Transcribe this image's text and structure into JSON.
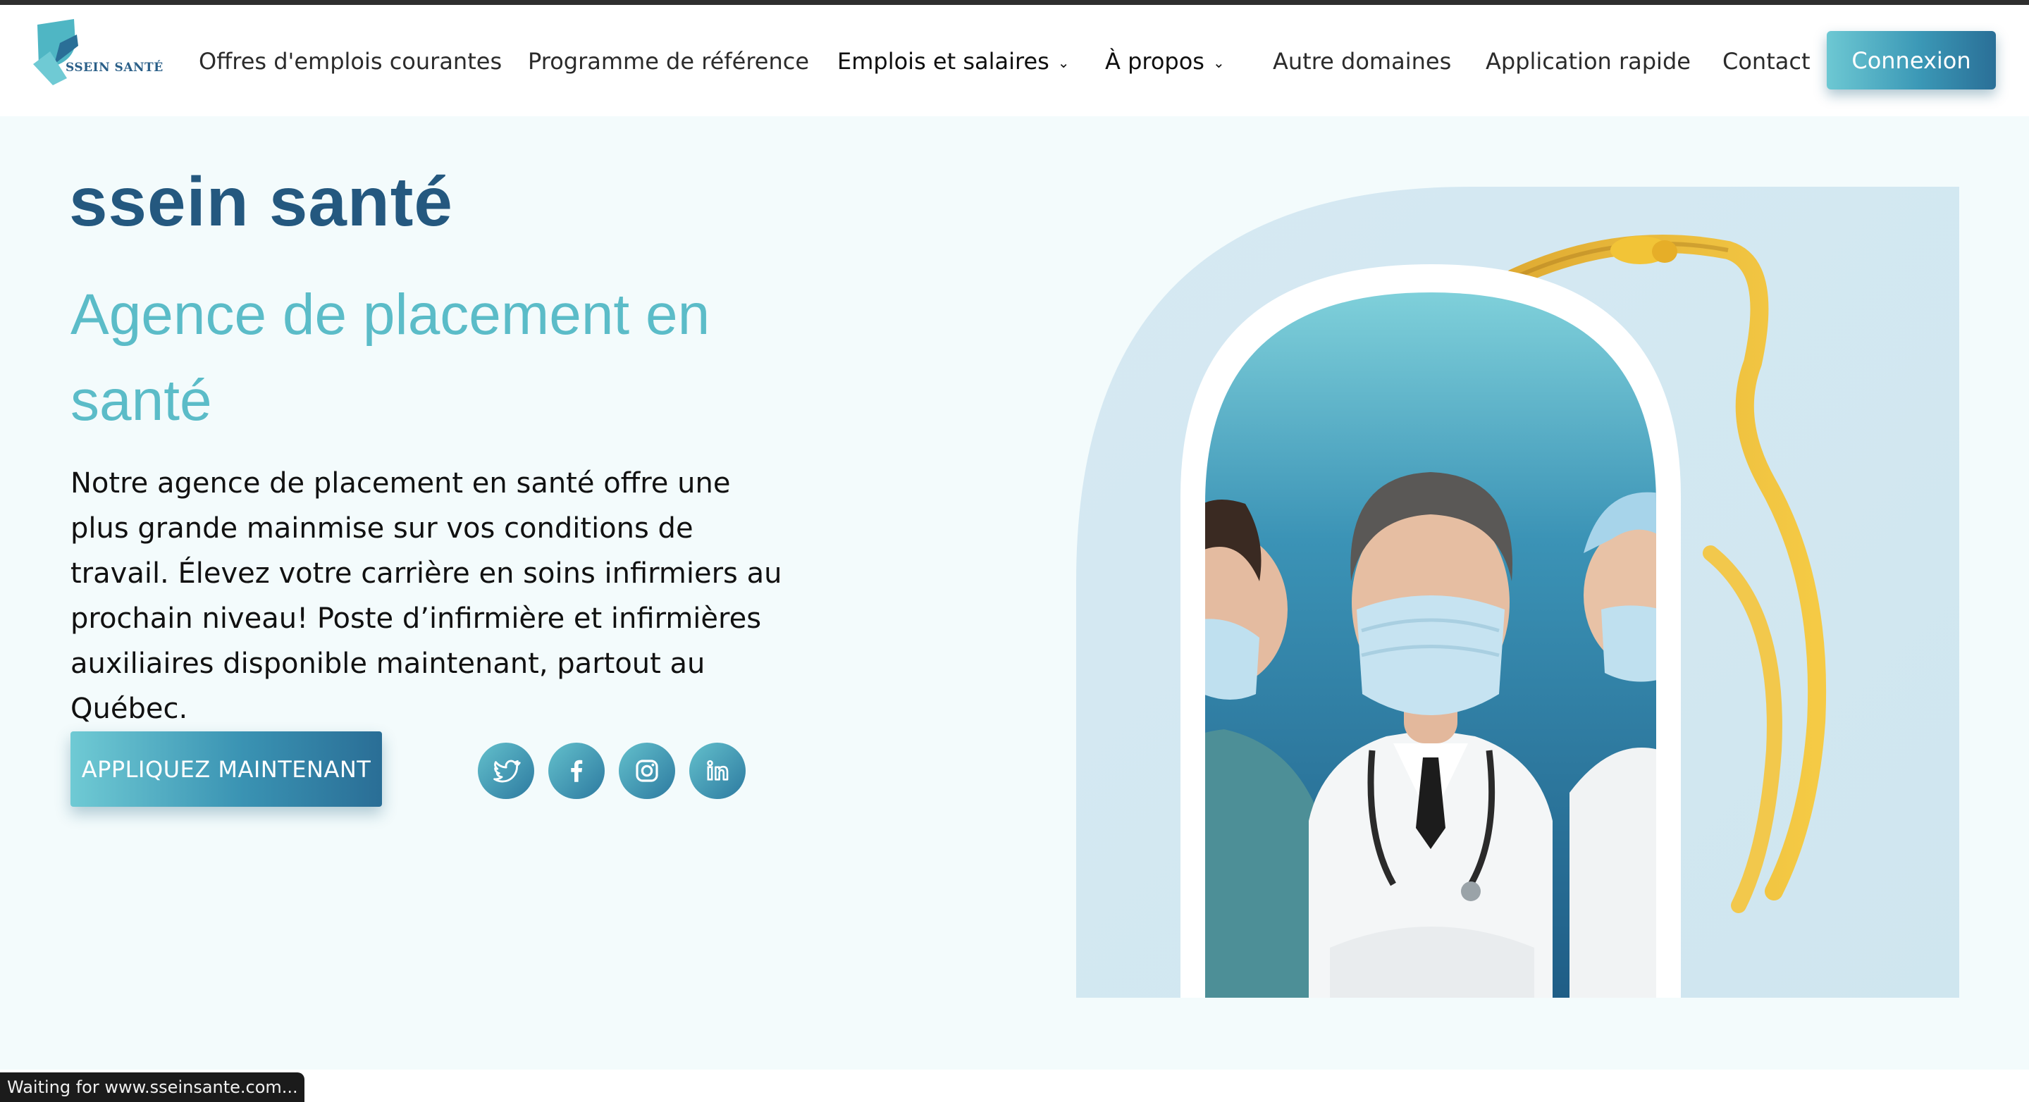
{
  "brand": {
    "logo_text": "SSEIN SANTÉ"
  },
  "nav": {
    "items": [
      {
        "label": "Offres d'emplois courantes"
      },
      {
        "label": "Programme de référence"
      },
      {
        "label": "Emplois et salaires"
      },
      {
        "label": "À propos"
      },
      {
        "label": "Autre domaines"
      },
      {
        "label": "Application rapide"
      },
      {
        "label": "Contact"
      }
    ],
    "login_label": "Connexion"
  },
  "hero": {
    "title": "ssein santé",
    "subtitle": "Agence de placement en santé",
    "description": "Notre agence de placement en santé offre une plus grande mainmise sur vos conditions de travail. Élevez votre carrière en soins infirmiers au prochain niveau! Poste d’infirmière et infirmières auxiliaires disponible maintenant, partout au Québec.",
    "cta_label": "APPLIQUEZ MAINTENANT",
    "social_icons": [
      "twitter-icon",
      "facebook-icon",
      "instagram-icon",
      "linkedin-icon"
    ]
  },
  "status_bar": {
    "text": "Waiting for www.sseinsante.com..."
  },
  "colors": {
    "primary_dark": "#24587f",
    "accent": "#5bbcc8",
    "hero_background": "#f3fbfc",
    "button_gradient_start": "#6fcad4",
    "button_gradient_end": "#2a6e96"
  }
}
